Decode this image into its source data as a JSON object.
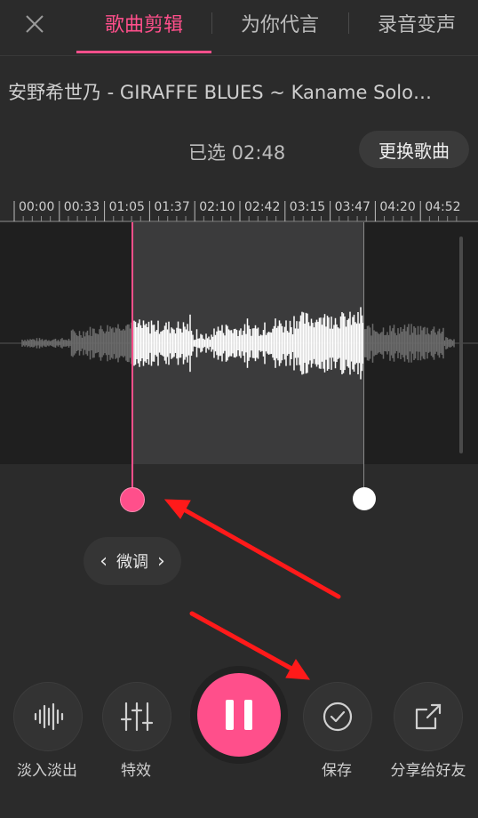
{
  "header": {
    "close_icon": "close-icon",
    "tabs": [
      {
        "label": "歌曲剪辑",
        "active": true
      },
      {
        "label": "为你代言",
        "active": false
      },
      {
        "label": "录音变声",
        "active": false
      }
    ]
  },
  "song": {
    "title": "安野希世乃 - GIRAFFE BLUES ~ Kaname Solo…",
    "selected": "已选 02:48",
    "change_label": "更换歌曲"
  },
  "timeline": {
    "ticks": [
      "00:00",
      "00:33",
      "01:05",
      "01:37",
      "02:10",
      "02:42",
      "03:15",
      "03:47",
      "04:20",
      "04:52"
    ]
  },
  "editor": {
    "fine_tune_label": "微调"
  },
  "controls": {
    "fade_label": "淡入淡出",
    "effects_label": "特效",
    "save_label": "保存",
    "share_label": "分享给好友"
  },
  "colors": {
    "accent": "#ff4f8b",
    "background": "#2b2b2b",
    "annotation_arrow": "#ff1a1a"
  }
}
